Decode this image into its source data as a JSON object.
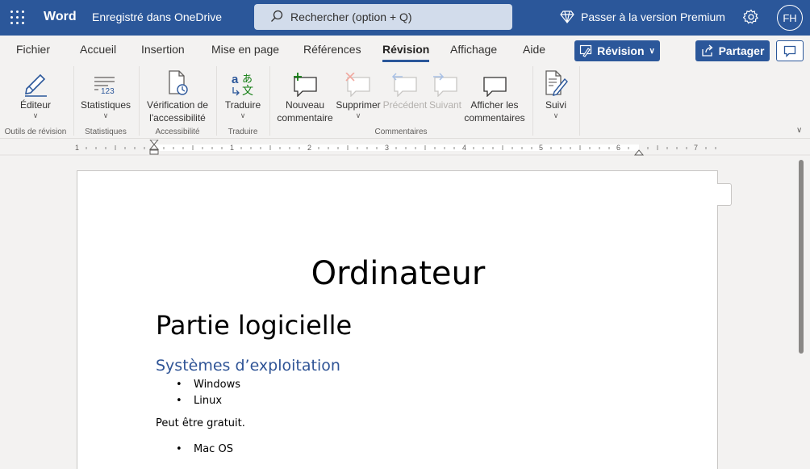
{
  "titlebar": {
    "app_name": "Word",
    "save_status": "Enregistré dans OneDrive",
    "search_placeholder": "Rechercher (option + Q)",
    "premium": "Passer à la version Premium",
    "user_initials": "FH"
  },
  "tabs": [
    "Fichier",
    "Accueil",
    "Insertion",
    "Mise en page",
    "Références",
    "Révision",
    "Affichage",
    "Aide"
  ],
  "active_tab": "Révision",
  "mode_button": "Révision",
  "share_button": "Partager",
  "ribbon": {
    "editor": "Éditeur",
    "stats": "Statistiques",
    "access_1": "Vérification de",
    "access_2": "l'accessibilité",
    "translate": "Traduire",
    "new_comment_1": "Nouveau",
    "new_comment_2": "commentaire",
    "delete": "Supprimer",
    "previous": "Précédent",
    "next": "Suivant",
    "show_comments_1": "Afficher les",
    "show_comments_2": "commentaires",
    "tracking": "Suivi",
    "group_proofing": "Outils de révision",
    "group_stats": "Statistiques",
    "group_access": "Accessibilité",
    "group_translate": "Traduire",
    "group_comments": "Commentaires"
  },
  "ruler": [
    "1",
    "1",
    "2",
    "3",
    "4",
    "5",
    "6",
    "7"
  ],
  "document": {
    "title": "Ordinateur",
    "heading1": "Partie logicielle",
    "heading2": "Systèmes d’exploitation",
    "bullets": [
      "Windows",
      "Linux"
    ],
    "paragraph": "Peut être gratuit.",
    "bullets2": [
      "Mac OS"
    ]
  },
  "colors": {
    "brand": "#2b579a",
    "heading2": "#2f5496"
  },
  "icons": [
    "waffle-icon",
    "search-icon",
    "diamond-icon",
    "gear-icon",
    "comment-icon",
    "share-icon",
    "pen-icon"
  ]
}
